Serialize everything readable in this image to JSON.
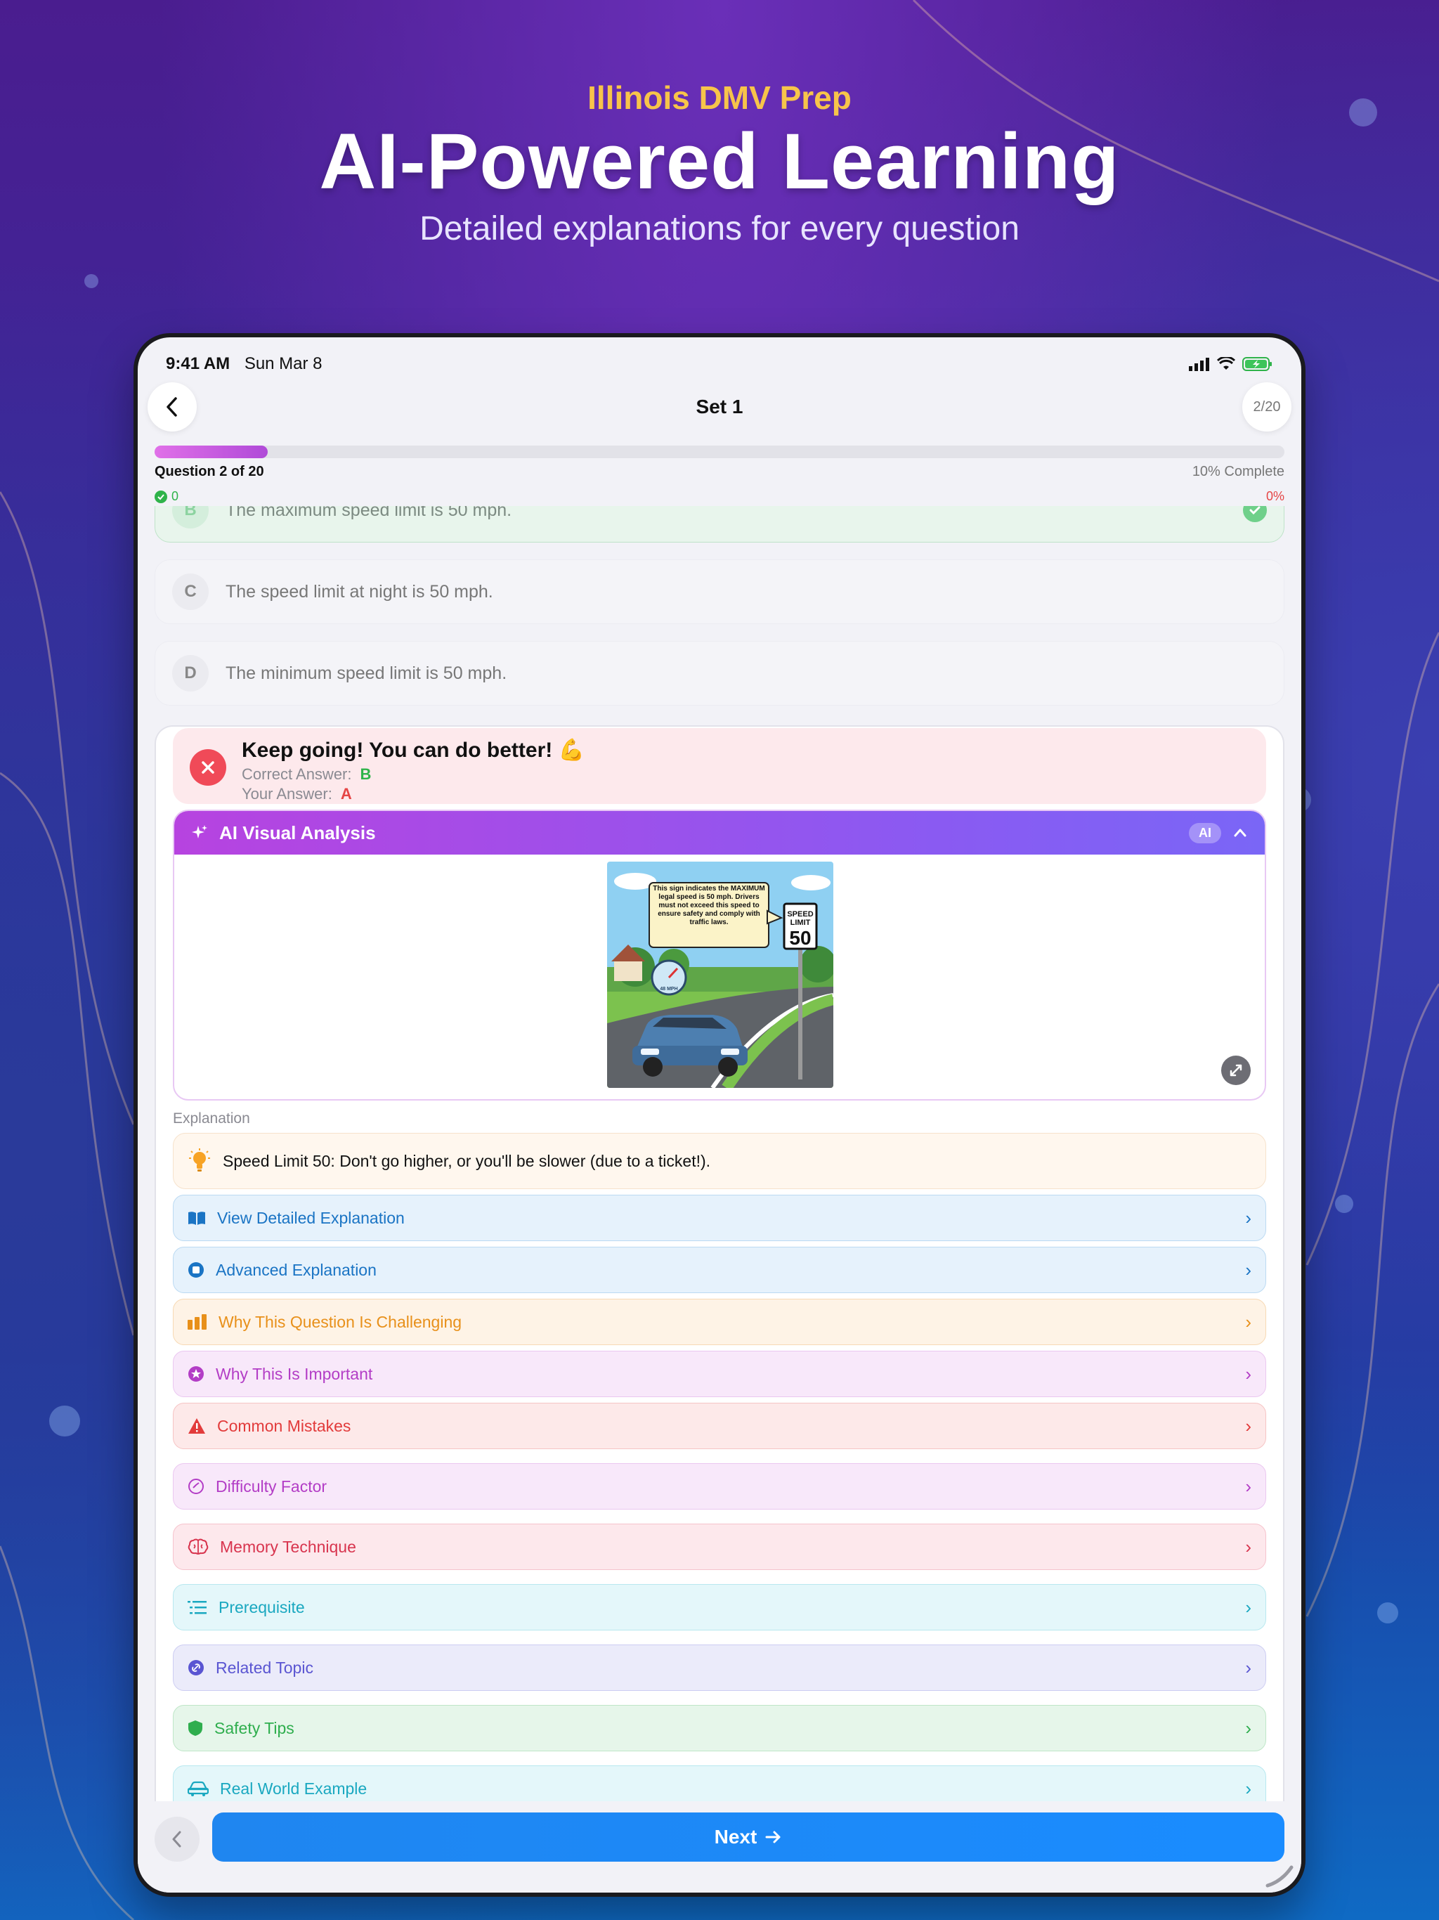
{
  "promo": {
    "eyebrow": "Illinois DMV Prep",
    "title": "AI-Powered Learning",
    "subtitle": "Detailed explanations for every question"
  },
  "statusbar": {
    "time": "9:41 AM",
    "date": "Sun Mar 8"
  },
  "nav": {
    "title": "Set 1",
    "counter": "2/20"
  },
  "progress": {
    "fraction": 0.1,
    "question_label": "Question 2 of 20",
    "percent_label": "10% Complete",
    "correct_count": "0",
    "score_percent": "0%"
  },
  "answers": [
    {
      "letter": "B",
      "text": "The maximum speed limit is 50 mph.",
      "state": "correct"
    },
    {
      "letter": "C",
      "text": "The speed limit at night is 50 mph.",
      "state": "neutral"
    },
    {
      "letter": "D",
      "text": "The minimum speed limit is 50 mph.",
      "state": "neutral"
    }
  ],
  "feedback": {
    "title": "Keep going! You can do better! 💪",
    "correct_label": "Correct Answer:",
    "correct_value": "B",
    "your_label": "Your Answer:",
    "your_value": "A"
  },
  "ai_panel": {
    "title": "AI Visual Analysis",
    "badge": "AI",
    "image": {
      "callout": "This sign indicates the MAXIMUM legal speed is 50 mph. Drivers must not exceed this speed to ensure safety and comply with traffic laws.",
      "sign_line1": "SPEED",
      "sign_line2": "LIMIT",
      "sign_number": "50",
      "gauge": "48 MPH"
    }
  },
  "explanation": {
    "label": "Explanation",
    "text": "Speed Limit 50: Don't go higher, or you'll be slower (due to a ticket!)."
  },
  "sections": [
    {
      "label": "View Detailed Explanation",
      "icon": "book-icon",
      "color": "blue"
    },
    {
      "label": "Advanced Explanation",
      "icon": "brain-circle-icon",
      "color": "blue"
    },
    {
      "label": "Why This Question Is Challenging",
      "icon": "bars-icon",
      "color": "orange"
    },
    {
      "label": "Why This Is Important",
      "icon": "star-circle-icon",
      "color": "purple"
    },
    {
      "label": "Common Mistakes",
      "icon": "warning-icon",
      "color": "red"
    },
    {
      "label": "Difficulty Factor",
      "icon": "gauge-icon",
      "color": "purple"
    },
    {
      "label": "Memory Technique",
      "icon": "brain-icon",
      "color": "pink"
    },
    {
      "label": "Prerequisite",
      "icon": "list-icon",
      "color": "teal"
    },
    {
      "label": "Related Topic",
      "icon": "link-icon",
      "color": "indigo"
    },
    {
      "label": "Safety Tips",
      "icon": "shield-icon",
      "color": "green"
    },
    {
      "label": "Real World Example",
      "icon": "car-icon",
      "color": "cyan"
    }
  ],
  "bottom": {
    "next_label": "Next"
  }
}
